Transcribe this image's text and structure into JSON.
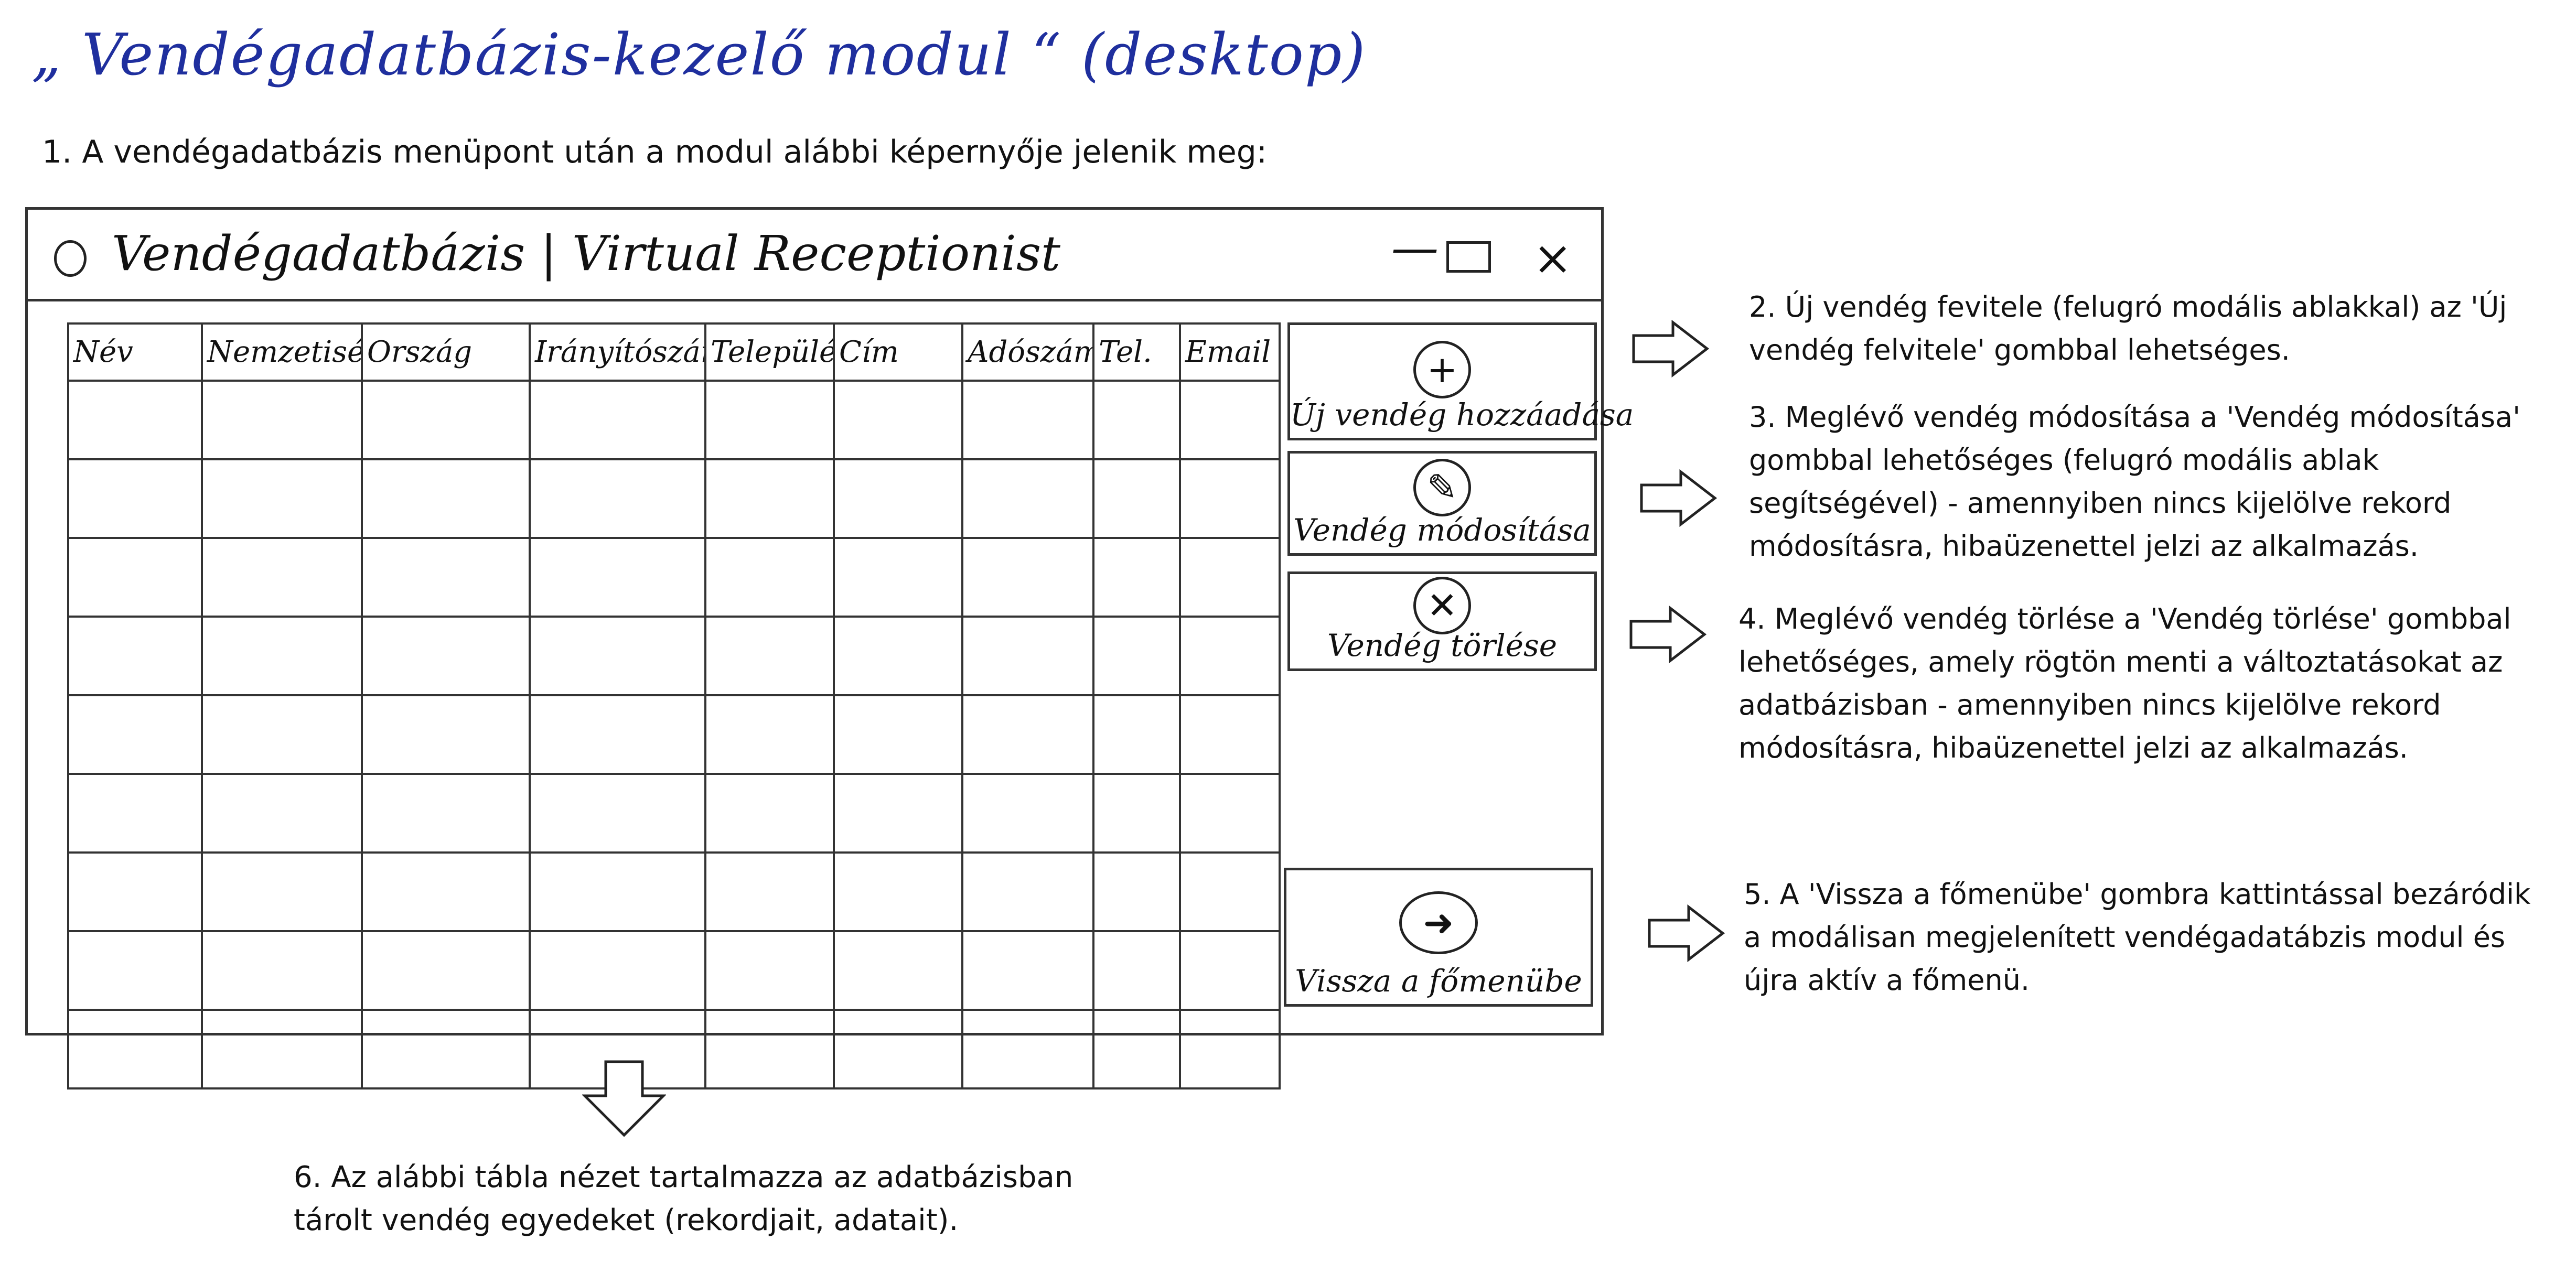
{
  "header": {
    "title": "„ Vendégadatbázis-kezelő modul “ (desktop)",
    "intro": "1. A vendégadatbázis menüpont után a modul alábbi képernyője jelenik meg:"
  },
  "window": {
    "title": "Vendégadatbázis | Virtual Receptionist",
    "controls": {
      "minimize": "—",
      "close": "×"
    }
  },
  "table": {
    "columns": [
      "Név",
      "Nemzetiség",
      "Ország",
      "Irányítószám",
      "Település",
      "Cím",
      "Adószám",
      "Tel.",
      "Email"
    ],
    "rows": 9
  },
  "buttons": {
    "add": {
      "label": "Új vendég hozzáadása",
      "icon": "plus-icon"
    },
    "edit": {
      "label": "Vendég módosítása",
      "icon": "pencil-icon"
    },
    "delete": {
      "label": "Vendég törlése",
      "icon": "x-icon"
    },
    "back": {
      "label": "Vissza a főmenübe",
      "icon": "arrow-right-icon"
    }
  },
  "notes": {
    "n2": "2. Új vendég fevitele (felugró modális ablakkal) az 'Új vendég felvitele' gombbal lehetséges.",
    "n3": "3. Meglévő vendég módosítása a 'Vendég módosítása' gombbal lehetőséges (felugró modális ablak segítségével) - amennyiben nincs kijelölve rekord módosításra, hibaüzenettel jelzi az alkalmazás.",
    "n4": "4. Meglévő vendég törlése a 'Vendég törlése' gombbal lehetőséges, amely rögtön menti a változtatásokat az adatbázisban - amennyiben nincs kijelölve rekord módosításra, hibaüzenettel jelzi az alkalmazás.",
    "n5": "5. A 'Vissza a főmenübe' gombra kattintással bezáródik a modálisan megjelenített vendégadatábzis modul és újra aktív a főmenü.",
    "n6": "6. Az alábbi tábla nézet tartalmazza az adatbázisban tárolt vendég egyedeket (rekordjait, adatait)."
  }
}
